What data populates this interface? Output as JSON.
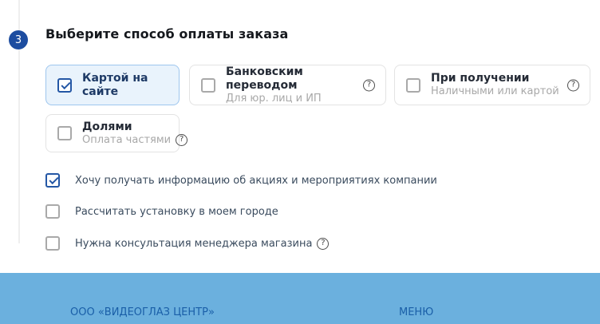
{
  "step": {
    "number": "3",
    "title": "Выберите способ оплаты заказа"
  },
  "payment_options": [
    {
      "label": "Картой на сайте",
      "sublabel": "",
      "checked": true,
      "has_help": false
    },
    {
      "label": "Банковским переводом",
      "sublabel": "Для юр. лиц и ИП",
      "checked": false,
      "has_help": true
    },
    {
      "label": "При получении",
      "sublabel": "Наличными или картой",
      "checked": false,
      "has_help": true
    },
    {
      "label": "Долями",
      "sublabel": "Оплата частями",
      "checked": false,
      "has_help": true
    }
  ],
  "checkboxes": [
    {
      "label": "Хочу получать информацию об акциях и мероприятиях компании",
      "checked": true,
      "has_help": false
    },
    {
      "label": "Рассчитать установку в моем городе",
      "checked": false,
      "has_help": false
    },
    {
      "label": "Нужна консультация менеджера магазина",
      "checked": false,
      "has_help": true
    }
  ],
  "footer": {
    "company": "ООО «ВИДЕОГЛАЗ ЦЕНТР»",
    "menu_label": "МЕНЮ"
  },
  "icons": {
    "help": "?"
  },
  "colors": {
    "step_circle": "#1d4da0",
    "selected_card_bg": "#e9f3fc",
    "selected_card_border": "#9ec6ee",
    "checkbox_checked": "#2457a5",
    "footer_bg": "#6bb0de",
    "footer_text": "#1a5fa8"
  }
}
